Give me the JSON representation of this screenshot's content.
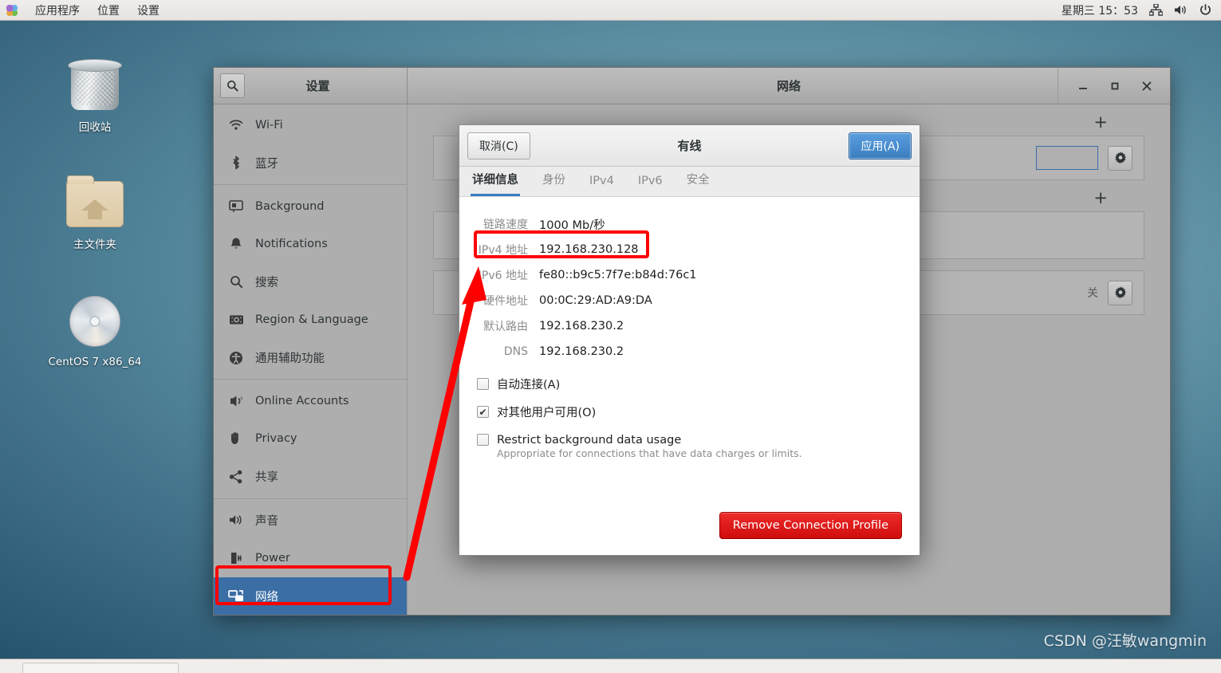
{
  "topbar": {
    "menu": [
      {
        "label": "应用程序",
        "name": "applications-menu"
      },
      {
        "label": "位置",
        "name": "places-menu"
      },
      {
        "label": "设置",
        "name": "system-menu"
      }
    ],
    "clock": "星期三 15：53",
    "icons": [
      "network-icon",
      "volume-icon",
      "power-icon"
    ]
  },
  "desktop": {
    "icons": [
      {
        "label": "回收站",
        "icon": "trash-icon"
      },
      {
        "label": "主文件夹",
        "icon": "home-folder-icon"
      },
      {
        "label": "CentOS 7 x86_64",
        "icon": "disc-icon"
      }
    ],
    "watermark": "CSDN @汪敏wangmin"
  },
  "window": {
    "sidebar_title": "设置",
    "title": "网络",
    "search_icon": "search-icon",
    "controls": {
      "minimize": "−",
      "maximize": "□",
      "close": "✕"
    }
  },
  "sidebar": {
    "items": [
      {
        "label": "Wi-Fi",
        "icon": "wifi-icon",
        "selected": false
      },
      {
        "label": "蓝牙",
        "icon": "bluetooth-icon",
        "selected": false
      },
      {
        "label": "Background",
        "icon": "background-icon",
        "selected": false
      },
      {
        "label": "Notifications",
        "icon": "bell-icon",
        "selected": false
      },
      {
        "label": "搜索",
        "icon": "search-icon",
        "selected": false
      },
      {
        "label": "Region & Language",
        "icon": "region-language-icon",
        "selected": false
      },
      {
        "label": "通用辅助功能",
        "icon": "accessibility-icon",
        "selected": false
      },
      {
        "label": "Online Accounts",
        "icon": "online-accounts-icon",
        "selected": false
      },
      {
        "label": "Privacy",
        "icon": "privacy-hand-icon",
        "selected": false
      },
      {
        "label": "共享",
        "icon": "sharing-icon",
        "selected": false
      },
      {
        "label": "声音",
        "icon": "sound-icon",
        "selected": false
      },
      {
        "label": "Power",
        "icon": "power-plug-icon",
        "selected": false
      },
      {
        "label": "网络",
        "icon": "network-icon",
        "selected": true
      }
    ]
  },
  "panel": {
    "add_label": "+",
    "off_label": "关",
    "gear_icon": "gear-icon"
  },
  "dialog": {
    "cancel_label": "取消(C)",
    "title": "有线",
    "apply_label": "应用(A)",
    "tabs": [
      {
        "label": "详细信息",
        "active": true
      },
      {
        "label": "身份",
        "active": false
      },
      {
        "label": "IPv4",
        "active": false
      },
      {
        "label": "IPv6",
        "active": false
      },
      {
        "label": "安全",
        "active": false
      }
    ],
    "details": [
      {
        "label": "链路速度",
        "value": "1000 Mb/秒"
      },
      {
        "label": "IPv4 地址",
        "value": "192.168.230.128"
      },
      {
        "label": "IPv6 地址",
        "value": "fe80::b9c5:7f7e:b84d:76c1"
      },
      {
        "label": "硬件地址",
        "value": "00:0C:29:AD:A9:DA"
      },
      {
        "label": "默认路由",
        "value": "192.168.230.2"
      },
      {
        "label": "DNS",
        "value": "192.168.230.2"
      }
    ],
    "checkboxes": [
      {
        "label": "自动连接(A)",
        "checked": false,
        "sub": ""
      },
      {
        "label": "对其他用户可用(O)",
        "checked": true,
        "sub": ""
      },
      {
        "label": "Restrict background data usage",
        "checked": false,
        "sub": "Appropriate for connections that have data charges or limits."
      }
    ],
    "remove_label": "Remove Connection Profile"
  },
  "annotation": {
    "color": "#ff0000",
    "highlight_row": "IPv4 地址",
    "highlight_sidebar": "网络"
  }
}
